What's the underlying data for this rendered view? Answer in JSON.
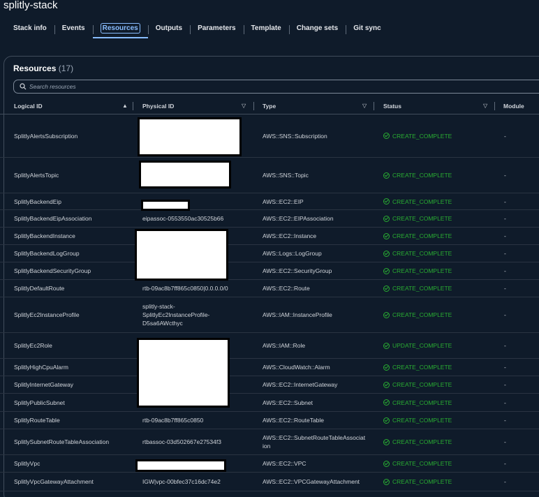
{
  "stack_title": "splitly-stack",
  "tabs": [
    {
      "label": "Stack info"
    },
    {
      "label": "Events"
    },
    {
      "label": "Resources"
    },
    {
      "label": "Outputs"
    },
    {
      "label": "Parameters"
    },
    {
      "label": "Template"
    },
    {
      "label": "Change sets"
    },
    {
      "label": "Git sync"
    }
  ],
  "active_tab": "Resources",
  "resources": {
    "title": "Resources",
    "count": "(17)",
    "search_placeholder": "Search resources",
    "columns": {
      "logical_id": "Logical ID",
      "physical_id": "Physical ID",
      "type": "Type",
      "status": "Status",
      "module": "Module"
    },
    "rows": [
      {
        "logical_id": "SplitlyAlertsSubscription",
        "physical_id": "",
        "type": "AWS::SNS::Subscription",
        "status": "CREATE_COMPLETE",
        "module": "-"
      },
      {
        "logical_id": "SplitlyAlertsTopic",
        "physical_id": "",
        "type": "AWS::SNS::Topic",
        "status": "CREATE_COMPLETE",
        "module": "-"
      },
      {
        "logical_id": "SplitlyBackendEip",
        "physical_id": "",
        "type": "AWS::EC2::EIP",
        "status": "CREATE_COMPLETE",
        "module": "-"
      },
      {
        "logical_id": "SplitlyBackendEipAssociation",
        "physical_id": "eipassoc-0553550ac30525b66",
        "type": "AWS::EC2::EIPAssociation",
        "status": "CREATE_COMPLETE",
        "module": "-"
      },
      {
        "logical_id": "SplitlyBackendInstance",
        "physical_id": "",
        "type": "AWS::EC2::Instance",
        "status": "CREATE_COMPLETE",
        "module": "-"
      },
      {
        "logical_id": "SplitlyBackendLogGroup",
        "physical_id": "",
        "type": "AWS::Logs::LogGroup",
        "status": "CREATE_COMPLETE",
        "module": "-"
      },
      {
        "logical_id": "SplitlyBackendSecurityGroup",
        "physical_id": "",
        "type": "AWS::EC2::SecurityGroup",
        "status": "CREATE_COMPLETE",
        "module": "-"
      },
      {
        "logical_id": "SplitlyDefaultRoute",
        "physical_id": "rtb-09ac8b7ff865c0850|0.0.0.0/0",
        "type": "AWS::EC2::Route",
        "status": "CREATE_COMPLETE",
        "module": "-"
      },
      {
        "logical_id": "SplitlyEc2InstanceProfile",
        "physical_id": "splitly-stack-SplitlyEc2InstanceProfile-D5sa6AWcthyc",
        "type": "AWS::IAM::InstanceProfile",
        "status": "CREATE_COMPLETE",
        "module": "-"
      },
      {
        "logical_id": "SplitlyEc2Role",
        "physical_id": "",
        "type": "AWS::IAM::Role",
        "status": "UPDATE_COMPLETE",
        "module": "-"
      },
      {
        "logical_id": "SplitlyHighCpuAlarm",
        "physical_id": "",
        "type": "AWS::CloudWatch::Alarm",
        "status": "CREATE_COMPLETE",
        "module": "-"
      },
      {
        "logical_id": "SplitlyInternetGateway",
        "physical_id": "",
        "type": "AWS::EC2::InternetGateway",
        "status": "CREATE_COMPLETE",
        "module": "-"
      },
      {
        "logical_id": "SplitlyPublicSubnet",
        "physical_id": "",
        "type": "AWS::EC2::Subnet",
        "status": "CREATE_COMPLETE",
        "module": "-"
      },
      {
        "logical_id": "SplitlyRouteTable",
        "physical_id": "rtb-09ac8b7ff865c0850",
        "type": "AWS::EC2::RouteTable",
        "status": "CREATE_COMPLETE",
        "module": "-"
      },
      {
        "logical_id": "SplitlySubnetRouteTableAssociation",
        "physical_id": "rtbassoc-03d502667e27534f3",
        "type": "AWS::EC2::SubnetRouteTableAssociation",
        "status": "CREATE_COMPLETE",
        "module": "-"
      },
      {
        "logical_id": "SplitlyVpc",
        "physical_id": "",
        "type": "AWS::EC2::VPC",
        "status": "CREATE_COMPLETE",
        "module": "-"
      },
      {
        "logical_id": "SplitlyVpcGatewayAttachment",
        "physical_id": "IGW|vpc-00bfec37c16dc74e2",
        "type": "AWS::EC2::VPCGatewayAttachment",
        "status": "CREATE_COMPLETE",
        "module": "-"
      }
    ]
  },
  "colors": {
    "background": "#0f1b2a",
    "accent": "#89bdff",
    "status_success": "#29ad32",
    "border": "#414d5c"
  }
}
